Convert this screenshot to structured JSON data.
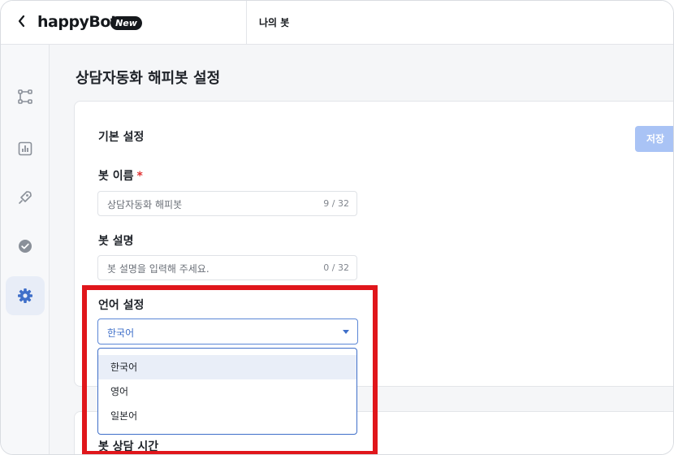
{
  "topbar": {
    "logo_text": "happyBot",
    "badge": "New",
    "tab_label": "나의 봇"
  },
  "sidebar": {
    "items": [
      {
        "icon": "flow-icon",
        "active": false
      },
      {
        "icon": "chart-icon",
        "active": false
      },
      {
        "icon": "rocket-icon",
        "active": false
      },
      {
        "icon": "check-circle-icon",
        "active": false
      },
      {
        "icon": "gear-icon",
        "active": true
      }
    ]
  },
  "main": {
    "page_title": "상담자동화 해피봇 설정",
    "section_title": "기본 설정",
    "save_label": "저장",
    "bot_name": {
      "label": "봇 이름",
      "required_mark": "*",
      "value": "상담자동화 해피봇",
      "count": "9 / 32"
    },
    "bot_desc": {
      "label": "봇 설명",
      "placeholder": "봇 설명을 입력해 주세요.",
      "count": "0 / 32"
    },
    "language": {
      "label": "언어 설정",
      "selected": "한국어",
      "options": [
        "한국어",
        "영어",
        "일본어"
      ]
    },
    "next_section_title": "봇 상담 시간"
  },
  "colors": {
    "accent": "#3f6fc9",
    "highlight": "#e0161b",
    "save_button": "#a9c3f5"
  }
}
